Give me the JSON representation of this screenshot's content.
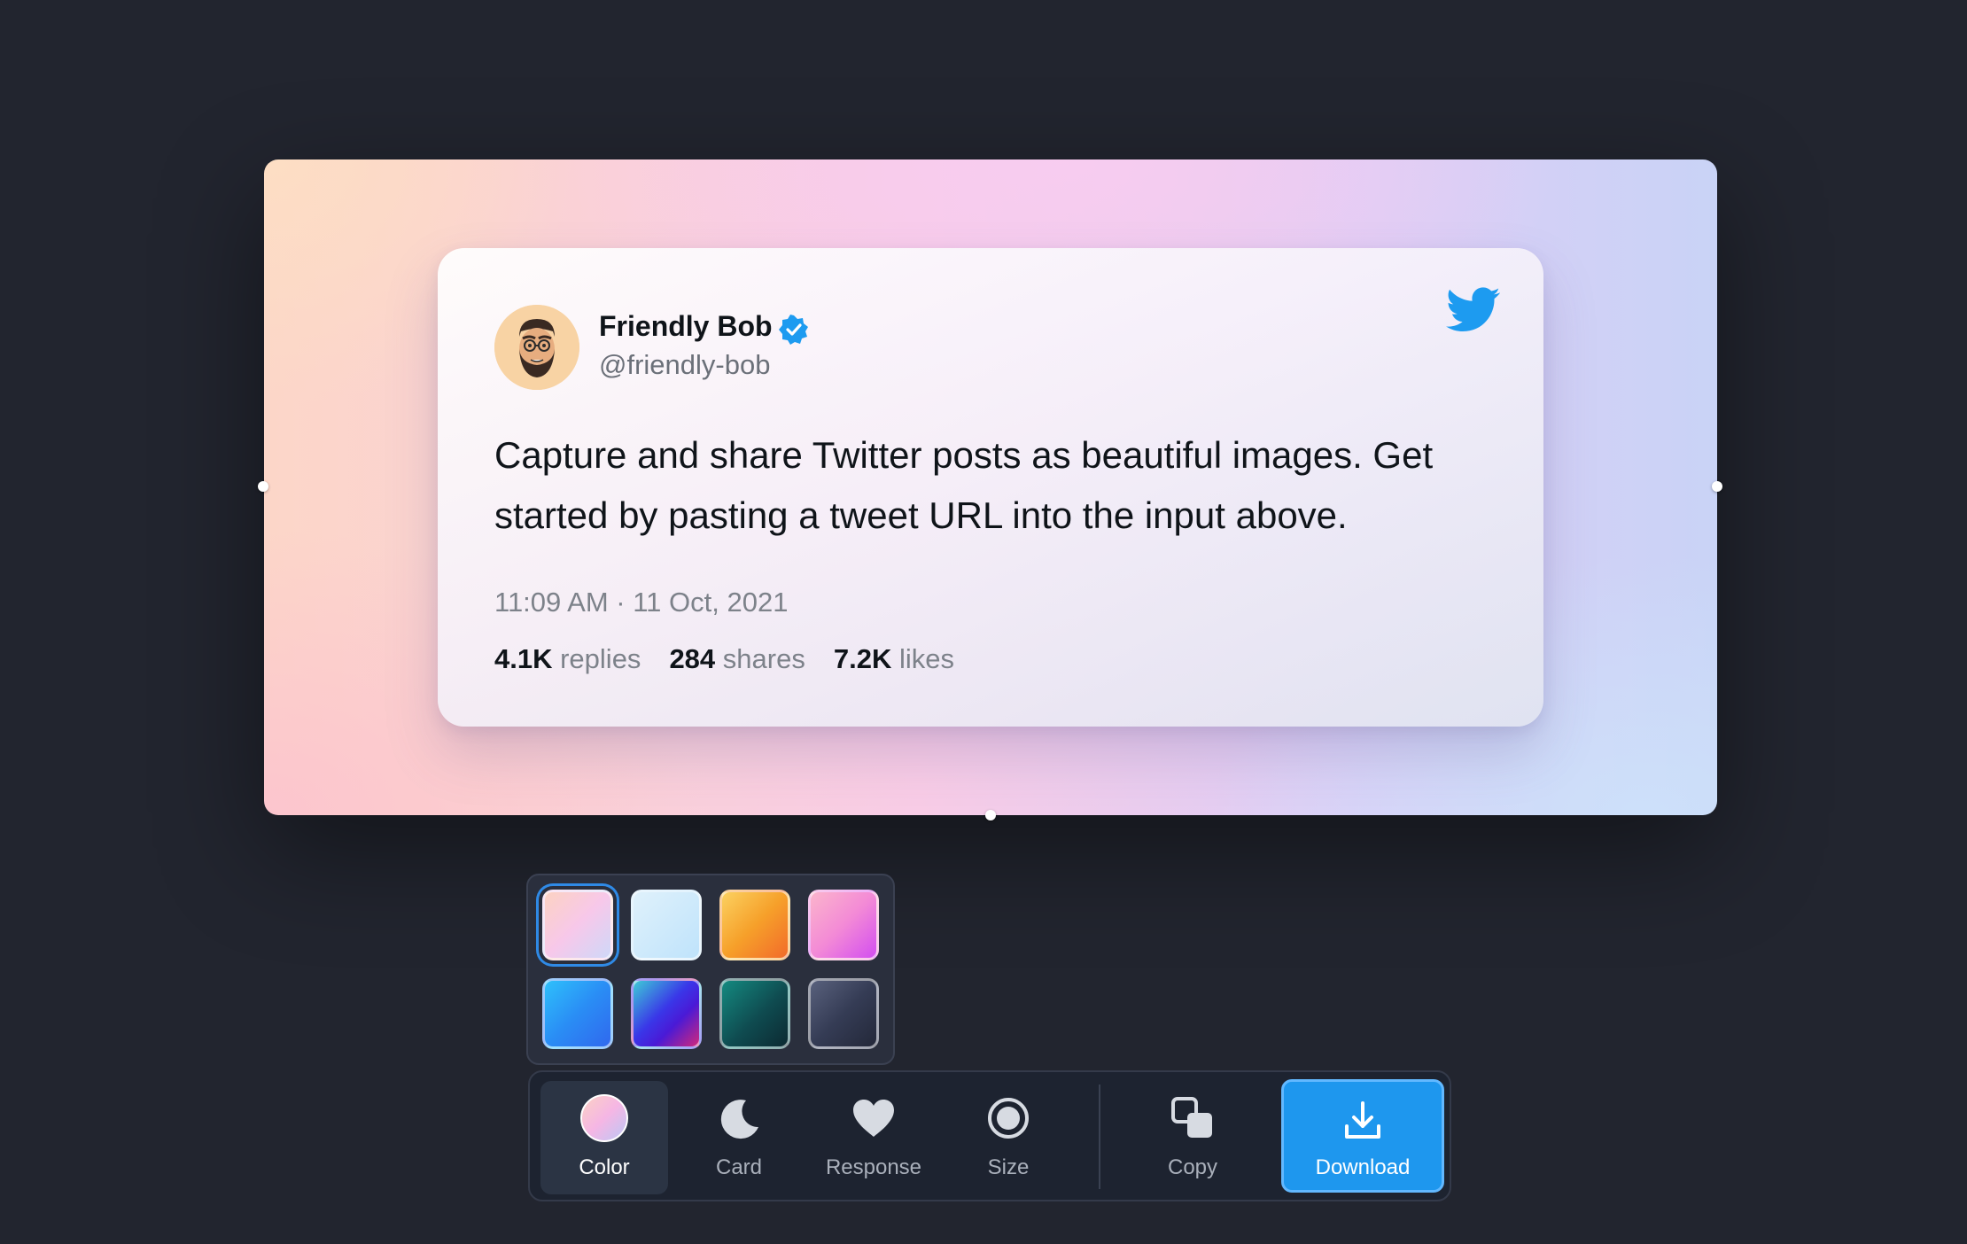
{
  "tweet": {
    "author_name": "Friendly Bob",
    "author_handle": "@friendly-bob",
    "verified": true,
    "text": "Capture and share Twitter posts as beautiful images. Get started by pasting a tweet URL into the input above.",
    "timestamp": "11:09 AM · 11 Oct, 2021",
    "stats": {
      "replies_count": "4.1K",
      "replies_label": "replies",
      "shares_count": "284",
      "shares_label": "shares",
      "likes_count": "7.2K",
      "likes_label": "likes"
    },
    "brand_icon": "twitter-bird-icon"
  },
  "palette": {
    "selected_index": 0,
    "swatches": [
      {
        "name": "pastel-peach-lilac"
      },
      {
        "name": "light-sky"
      },
      {
        "name": "orange-sunset"
      },
      {
        "name": "pink-magenta"
      },
      {
        "name": "blue"
      },
      {
        "name": "violet-blue"
      },
      {
        "name": "teal-dark"
      },
      {
        "name": "slate"
      }
    ]
  },
  "toolbar": {
    "color_label": "Color",
    "card_label": "Card",
    "response_label": "Response",
    "size_label": "Size",
    "copy_label": "Copy",
    "download_label": "Download",
    "active_tool": "Color"
  },
  "colors": {
    "page_background": "#22252f",
    "accent": "#1e97ee",
    "twitter_blue": "#1d9bf0",
    "toolbar_background": "#1d2330"
  }
}
